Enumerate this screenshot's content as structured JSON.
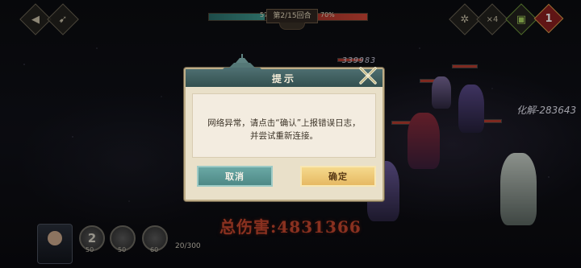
{
  "top_bar": {
    "round_label": "第2/15回合",
    "progress_left_pct": "57%",
    "progress_right_pct": "70%",
    "speed_label": "×4",
    "notification_count": "1",
    "icons": [
      "back-arrow-icon",
      "double-arrow-icon",
      "settings-gear-icon",
      "speed-icon",
      "auto-battle-icon"
    ]
  },
  "battle": {
    "damage_number_top": "339983",
    "damage_number_right": "化解-283643",
    "total_damage": "总伤害:4831366"
  },
  "bottom_bar": {
    "skill_1_value": "2",
    "skill_1_cost": "50",
    "skill_2_cost": "50",
    "skill_3_cost": "60",
    "energy": "20/300"
  },
  "dialog": {
    "title": "提示",
    "message_line1": "网络异常，请点击“确认”上报错误日志，",
    "message_line2": "并尝试重新连接。",
    "cancel_label": "取消",
    "confirm_label": "确定"
  },
  "colors": {
    "dialog_header": "#3f5f60",
    "dialog_body": "#e9e0c9",
    "cancel_button": "#5d9896",
    "confirm_button": "#efca78",
    "total_damage_text": "#c4472e"
  }
}
